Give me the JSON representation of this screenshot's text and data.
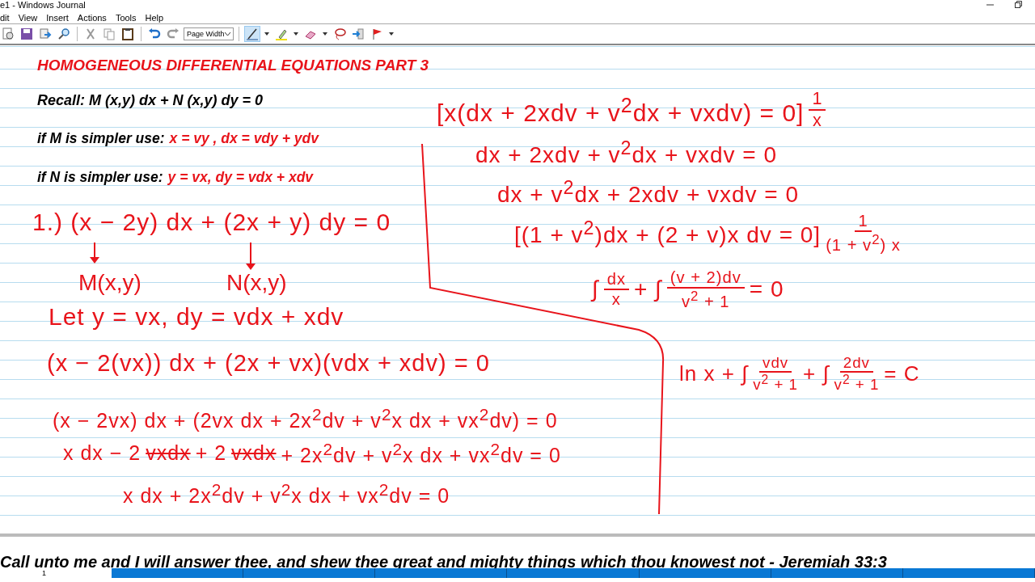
{
  "window": {
    "title": "e1 - Windows Journal"
  },
  "menu": [
    "dit",
    "View",
    "Insert",
    "Actions",
    "Tools",
    "Help"
  ],
  "toolbar": {
    "buttons": [
      {
        "kind": "new-page"
      },
      {
        "kind": "save"
      },
      {
        "kind": "send"
      },
      {
        "kind": "find"
      },
      {
        "kind": "cut"
      },
      {
        "kind": "copy"
      },
      {
        "kind": "paste"
      },
      {
        "kind": "undo"
      },
      {
        "kind": "redo"
      }
    ],
    "zoom": "Page Width",
    "tools": [
      {
        "kind": "pen",
        "selected": true,
        "dropdown": true
      },
      {
        "kind": "highlighter",
        "selected": false,
        "dropdown": true
      },
      {
        "kind": "eraser",
        "selected": false,
        "dropdown": true
      },
      {
        "kind": "lasso",
        "selected": false,
        "dropdown": false
      },
      {
        "kind": "insert-space",
        "selected": false,
        "dropdown": false
      },
      {
        "kind": "flag",
        "selected": false,
        "dropdown": true
      }
    ]
  },
  "page": {
    "title": "HOMOGENEOUS DIFFERENTIAL EQUATIONS PART 3",
    "recall": "Recall: M (x,y) dx + N (x,y) dy = 0",
    "rules": [
      {
        "condition": "if M is simpler use:",
        "formula": "x = vy , dx = vdy + ydv"
      },
      {
        "condition": "if N is simpler use:",
        "formula": "y = vx, dy = vdx + xdv"
      }
    ],
    "labels": [
      "M(x,y)",
      "N(x,y)"
    ],
    "ink": [
      {
        "parts": [
          {
            "kind": "text",
            "text": "1.) (x − 2y) dx + (2x + y) dy = 0"
          }
        ]
      },
      {
        "parts": [
          {
            "kind": "text",
            "text": "Let y = vx, dy = vdx + xdv"
          }
        ]
      },
      {
        "parts": [
          {
            "kind": "text",
            "text": "(x − 2(vx)) dx + (2x + vx)(vdx + xdv) = 0"
          }
        ]
      },
      {
        "parts": [
          {
            "kind": "text",
            "text": "(x − 2vx) dx + (2vx dx + 2x$^{2}$dv + v$^{2}$x dx + vx$^{2}$dv) = 0"
          }
        ]
      },
      {
        "parts": [
          {
            "kind": "text",
            "text": "x dx − 2"
          },
          {
            "kind": "struck",
            "text": "vxdx"
          },
          {
            "kind": "text",
            "text": " + 2"
          },
          {
            "kind": "struck",
            "text": "vxdx"
          },
          {
            "kind": "text",
            "text": " + 2x$^{2}$dv + v$^{2}$x dx + vx$^{2}$dv = 0"
          }
        ]
      },
      {
        "parts": [
          {
            "kind": "text",
            "text": "x dx + 2x$^{2}$dv + v$^{2}$x dx + vx$^{2}$dv = 0"
          }
        ]
      },
      {
        "parts": [
          {
            "kind": "text",
            "text": "[x(dx + 2xdv + v$^{2}$dx + vxdv) = 0]"
          },
          {
            "kind": "frac",
            "numerator": "1",
            "denominator": "x"
          }
        ]
      },
      {
        "parts": [
          {
            "kind": "text",
            "text": "dx + 2xdv + v$^{2}$dx + vxdv = 0"
          }
        ]
      },
      {
        "parts": [
          {
            "kind": "text",
            "text": "dx + v$^{2}$dx + 2xdv + vxdv = 0"
          }
        ]
      },
      {
        "parts": [
          {
            "kind": "text",
            "text": "[(1 + v$^{2}$)dx + (2 + v)x dv = 0]"
          },
          {
            "kind": "frac",
            "numerator": "1",
            "denominator": "(1 + v$^{2}$) x"
          }
        ]
      },
      {
        "parts": [
          {
            "kind": "text",
            "text": "∫"
          },
          {
            "kind": "frac",
            "numerator": "dx",
            "denominator": "x"
          },
          {
            "kind": "text",
            "text": "+ ∫"
          },
          {
            "kind": "frac",
            "numerator": "(v + 2)dv",
            "denominator": "v$^{2}$ + 1"
          },
          {
            "kind": "text",
            "text": "= 0"
          }
        ]
      },
      {
        "parts": [
          {
            "kind": "text",
            "text": "ln x + ∫"
          },
          {
            "kind": "frac",
            "numerator": "vdv",
            "denominator": "v$^{2}$ + 1"
          },
          {
            "kind": "text",
            "text": "+ ∫"
          },
          {
            "kind": "frac",
            "numerator": "2dv",
            "denominator": "v$^{2}$ + 1"
          },
          {
            "kind": "text",
            "text": "= C"
          }
        ]
      }
    ]
  },
  "footer": {
    "quote": "Call unto me and I will answer thee, and shew thee great and mighty things which thou knowest not - Jeremiah 33:3",
    "page_number": "1"
  }
}
